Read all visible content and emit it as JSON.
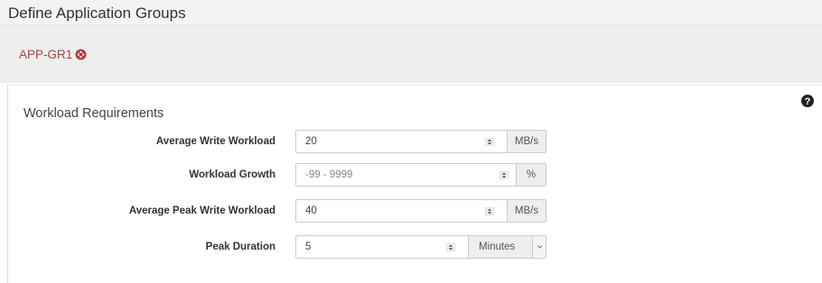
{
  "page": {
    "title": "Define Application Groups"
  },
  "groups": [
    {
      "label": "APP-GR1",
      "remove_icon": "remove-circle-icon"
    }
  ],
  "panel": {
    "help_icon": "question-circle-icon",
    "section_title": "Workload Requirements",
    "fields": [
      {
        "label": "Average Write Workload",
        "value": "20",
        "placeholder": "",
        "unit": "MB/s"
      },
      {
        "label": "Workload Growth",
        "value": "",
        "placeholder": "-99 - 9999",
        "unit": "%"
      },
      {
        "label": "Average Peak Write Workload",
        "value": "40",
        "placeholder": "",
        "unit": "MB/s"
      },
      {
        "label": "Peak Duration",
        "value": "5",
        "placeholder": "",
        "unit_select": "Minutes"
      }
    ]
  },
  "colors": {
    "group_label": "#a94442",
    "header_bg": "#f3f3f3",
    "tabs_bg": "#eeeeee",
    "addon_bg": "#eeeeee",
    "border": "#cccccc"
  }
}
